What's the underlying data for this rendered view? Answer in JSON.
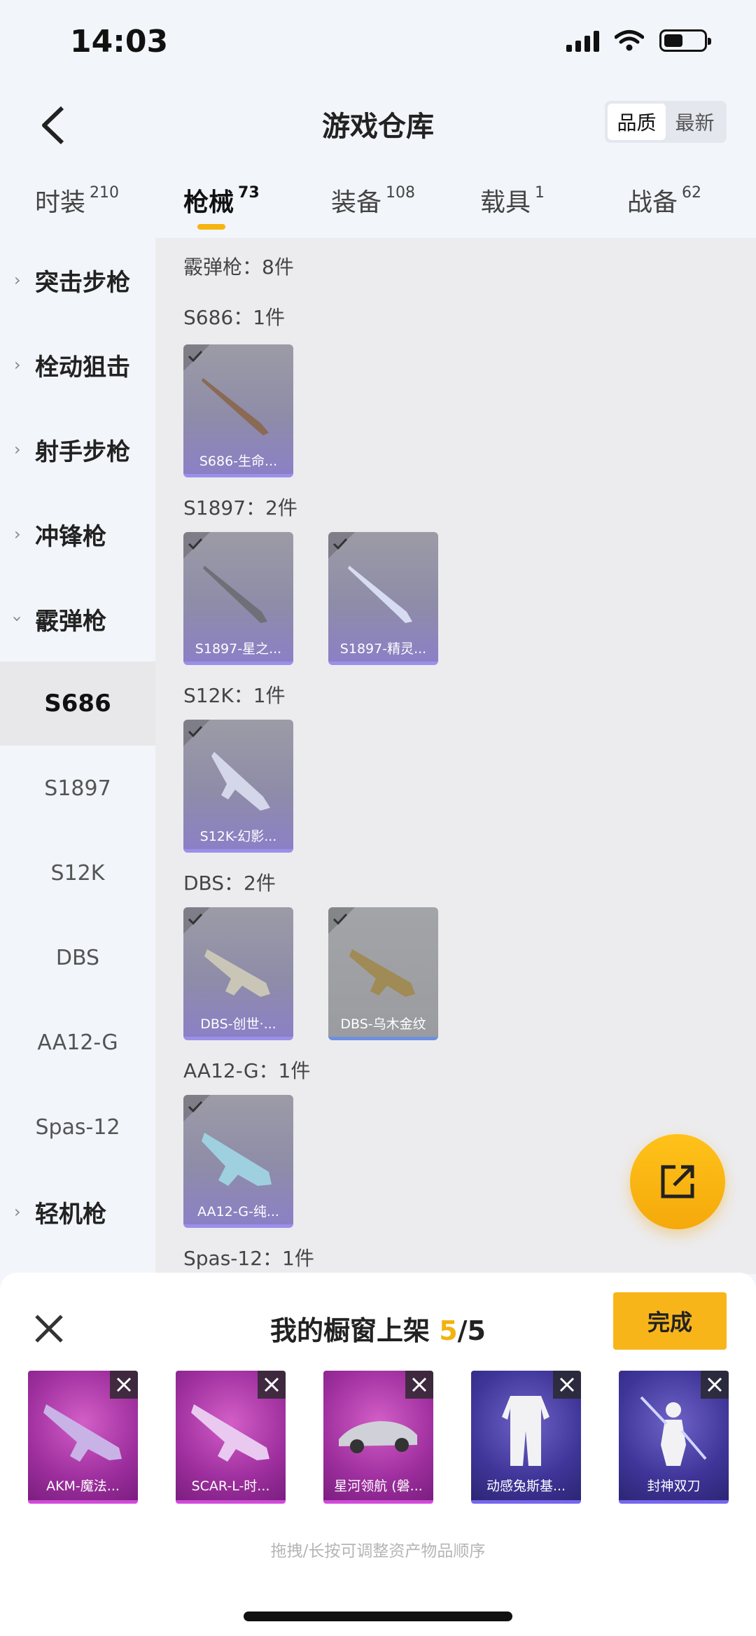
{
  "status": {
    "time": "14:03"
  },
  "header": {
    "title": "游戏仓库",
    "sort_quality": "品质",
    "sort_newest": "最新"
  },
  "tabs": [
    {
      "label": "时装",
      "count": "210"
    },
    {
      "label": "枪械",
      "count": "73"
    },
    {
      "label": "装备",
      "count": "108"
    },
    {
      "label": "载具",
      "count": "1"
    },
    {
      "label": "战备",
      "count": "62"
    }
  ],
  "sidebar": {
    "categories": [
      "突击步枪",
      "栓动狙击",
      "射手步枪",
      "冲锋枪",
      "霰弹枪",
      "轻机枪"
    ],
    "subcategories": [
      "S686",
      "S1897",
      "S12K",
      "DBS",
      "AA12-G",
      "Spas-12"
    ]
  },
  "content": {
    "section_header": "霰弹枪：8件",
    "groups": [
      {
        "label": "S686：1件",
        "items": [
          "S686-生命..."
        ]
      },
      {
        "label": "S1897：2件",
        "items": [
          "S1897-星之...",
          "S1897-精灵..."
        ]
      },
      {
        "label": "S12K：1件",
        "items": [
          "S12K-幻影..."
        ]
      },
      {
        "label": "DBS：2件",
        "items": [
          "DBS-创世·...",
          "DBS-乌木金纹"
        ]
      },
      {
        "label": "AA12-G：1件",
        "items": [
          "AA12-G-纯..."
        ]
      },
      {
        "label": "Spas-12：1件",
        "items": []
      }
    ]
  },
  "showcase": {
    "title_prefix": "我的橱窗上架 ",
    "count_current": "5",
    "count_total": "/5",
    "done_label": "完成",
    "items": [
      "AKM-魔法...",
      "SCAR-L-时...",
      "星河领航 (磐...",
      "动感兔斯基...",
      "封神双刀"
    ],
    "hint": "拖拽/长按可调整资产物品顺序"
  },
  "colors": {
    "accent": "#f8b51a",
    "tab_underline": "#f6b40f"
  }
}
